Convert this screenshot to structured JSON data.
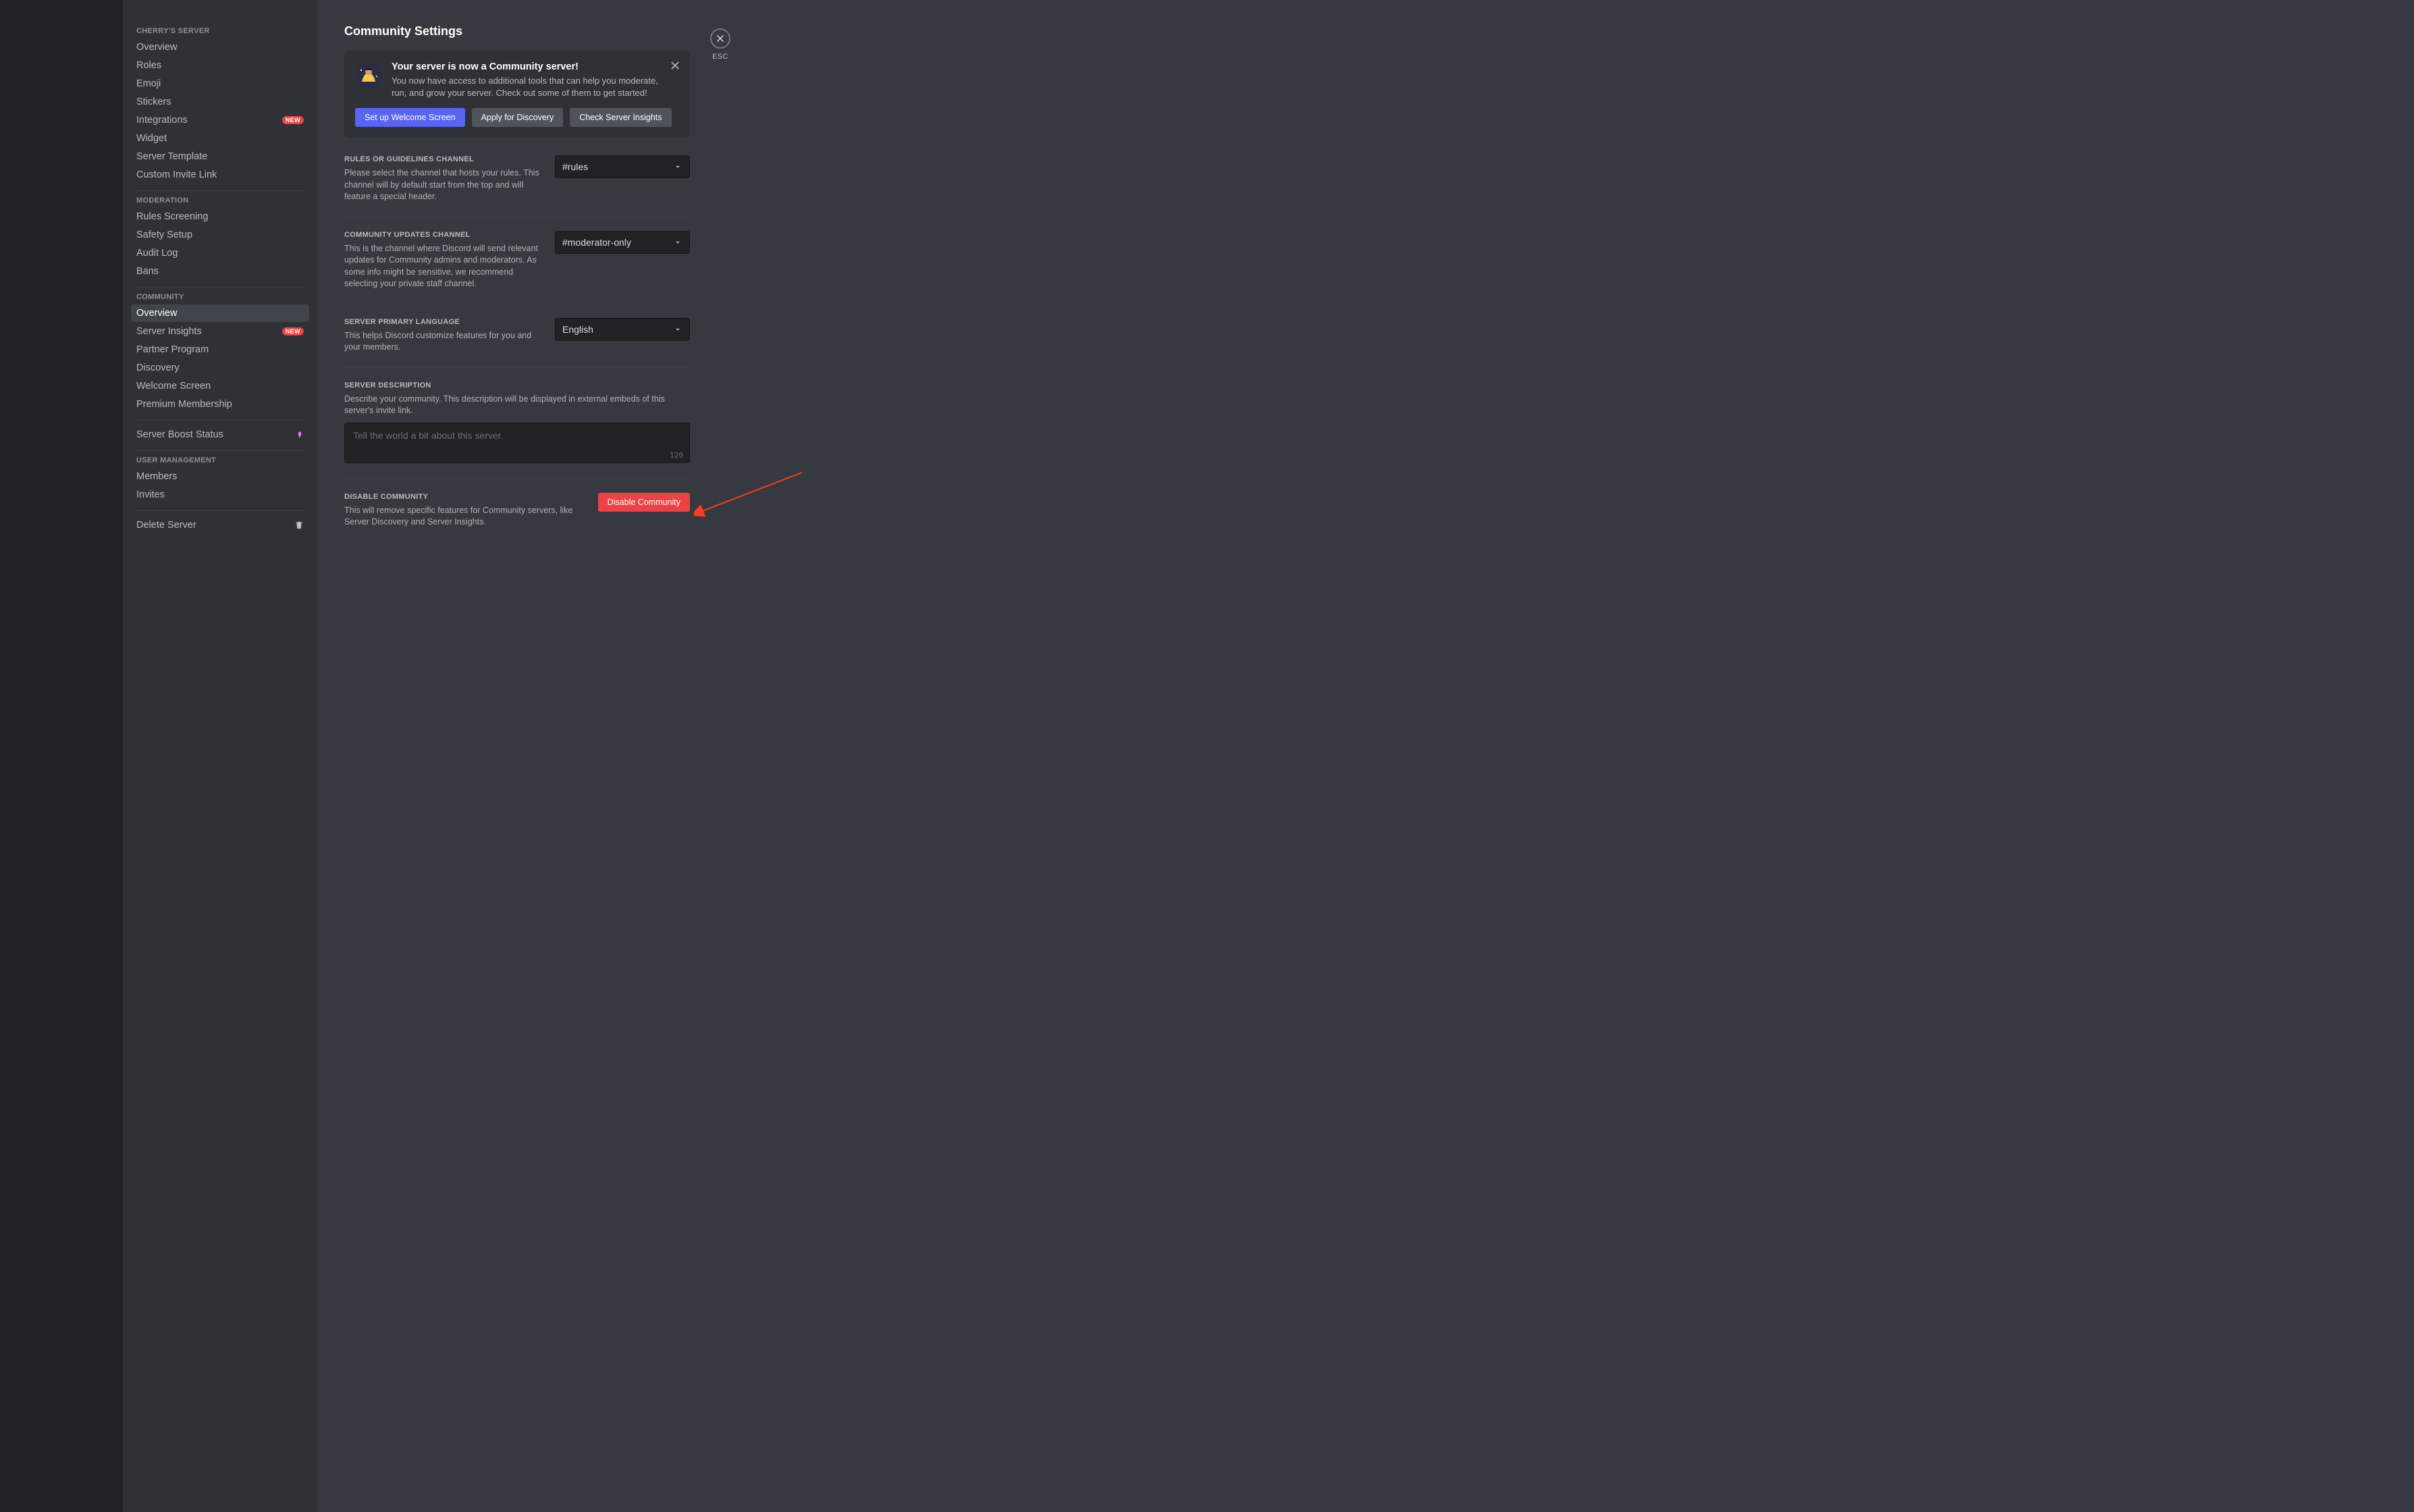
{
  "sidebar": {
    "server_heading": "Cherry's Server",
    "moderation_heading": "Moderation",
    "community_heading": "Community",
    "user_mgmt_heading": "User Management",
    "new_badge": "New",
    "items_server": [
      {
        "label": "Overview"
      },
      {
        "label": "Roles"
      },
      {
        "label": "Emoji"
      },
      {
        "label": "Stickers"
      },
      {
        "label": "Integrations",
        "new": true
      },
      {
        "label": "Widget"
      },
      {
        "label": "Server Template"
      },
      {
        "label": "Custom Invite Link"
      }
    ],
    "items_moderation": [
      {
        "label": "Rules Screening"
      },
      {
        "label": "Safety Setup"
      },
      {
        "label": "Audit Log"
      },
      {
        "label": "Bans"
      }
    ],
    "items_community": [
      {
        "label": "Overview",
        "selected": true
      },
      {
        "label": "Server Insights",
        "new": true
      },
      {
        "label": "Partner Program"
      },
      {
        "label": "Discovery"
      },
      {
        "label": "Welcome Screen"
      },
      {
        "label": "Premium Membership"
      }
    ],
    "boost_label": "Server Boost Status",
    "items_users": [
      {
        "label": "Members"
      },
      {
        "label": "Invites"
      }
    ],
    "delete_label": "Delete Server"
  },
  "page": {
    "title": "Community Settings",
    "close_label": "ESC"
  },
  "callout": {
    "title": "Your server is now a Community server!",
    "desc": "You now have access to additional tools that can help you moderate, run, and grow your server. Check out some of them to get started!",
    "btn_welcome": "Set up Welcome Screen",
    "btn_discovery": "Apply for Discovery",
    "btn_insights": "Check Server Insights"
  },
  "sections": {
    "rules": {
      "label": "Rules or Guidelines Channel",
      "desc": "Please select the channel that hosts your rules. This channel will by default start from the top and will feature a special header.",
      "value": "#rules"
    },
    "updates": {
      "label": "Community Updates Channel",
      "desc": "This is the channel where Discord will send relevant updates for Community admins and moderators. As some info might be sensitive, we recommend selecting your private staff channel.",
      "value": "#moderator-only"
    },
    "language": {
      "label": "Server Primary Language",
      "desc": "This helps Discord customize features for you and your members.",
      "value": "English"
    },
    "description": {
      "label": "Server Description",
      "desc": "Describe your community. This description will be displayed in external embeds of this server's invite link.",
      "placeholder": "Tell the world a bit about this server.",
      "value": "",
      "remaining": "120"
    },
    "disable": {
      "label": "Disable Community",
      "desc": "This will remove specific features for Community servers, like Server Discovery and Server Insights.",
      "button": "Disable Community"
    }
  }
}
